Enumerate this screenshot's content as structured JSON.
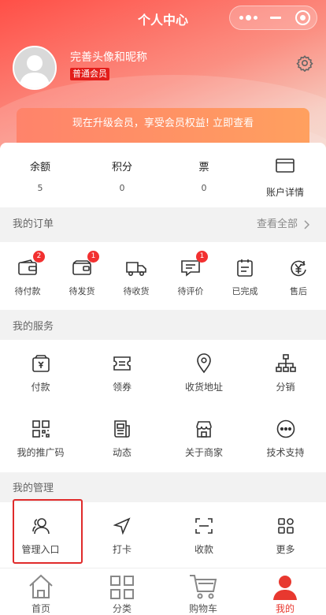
{
  "header": {
    "title": "个人中心"
  },
  "user": {
    "nickname": "完善头像和昵称",
    "level": "普通会员"
  },
  "promo": {
    "text": "现在升级会员，享受会员权益!  立即查看"
  },
  "balance": [
    {
      "label": "余额",
      "value": "5"
    },
    {
      "label": "积分",
      "value": "0"
    },
    {
      "label": "票",
      "value": "0"
    }
  ],
  "account_detail": {
    "label": "账户详情",
    "icon": "card-icon"
  },
  "orders": {
    "title": "我的订单",
    "see_all": "查看全部",
    "items": [
      {
        "label": "待付款",
        "icon": "wallet-icon",
        "badge": "2"
      },
      {
        "label": "待发货",
        "icon": "box-icon",
        "badge": "1"
      },
      {
        "label": "待收货",
        "icon": "truck-icon"
      },
      {
        "label": "待评价",
        "icon": "comment-icon",
        "badge": "1"
      },
      {
        "label": "已完成",
        "icon": "checklist-icon"
      },
      {
        "label": "售后",
        "icon": "yen-icon"
      }
    ]
  },
  "services": {
    "title": "我的服务",
    "items": [
      {
        "label": "付款",
        "icon": "payment-icon"
      },
      {
        "label": "领券",
        "icon": "coupon-icon"
      },
      {
        "label": "收货地址",
        "icon": "location-icon"
      },
      {
        "label": "分销",
        "icon": "network-icon"
      },
      {
        "label": "我的推广码",
        "icon": "qrcode-icon"
      },
      {
        "label": "动态",
        "icon": "news-icon"
      },
      {
        "label": "关于商家",
        "icon": "store-icon"
      },
      {
        "label": "技术支持",
        "icon": "more-dots-icon"
      }
    ]
  },
  "management": {
    "title": "我的管理",
    "items": [
      {
        "label": "管理入口",
        "icon": "users-icon"
      },
      {
        "label": "打卡",
        "icon": "navigation-icon"
      },
      {
        "label": "收款",
        "icon": "scan-icon"
      },
      {
        "label": "更多",
        "icon": "grid-icon"
      }
    ]
  },
  "tabbar": {
    "items": [
      {
        "label": "首页",
        "icon": "home-icon"
      },
      {
        "label": "分类",
        "icon": "category-icon"
      },
      {
        "label": "购物车",
        "icon": "cart-icon"
      },
      {
        "label": "我的",
        "icon": "profile-icon",
        "active": true
      }
    ]
  },
  "colors": {
    "accent": "#e8382f",
    "badge": "#e31d1a",
    "promo": "#ff8a68"
  }
}
